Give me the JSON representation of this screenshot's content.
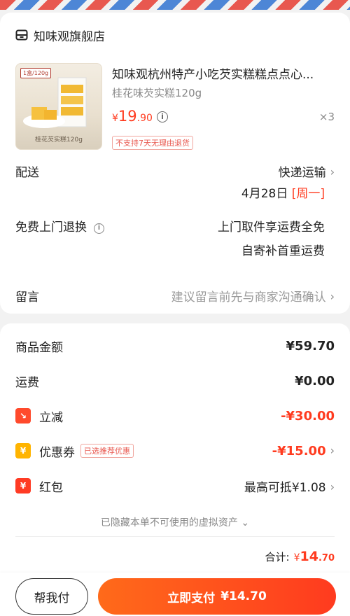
{
  "shop": {
    "name": "知味观旗舰店",
    "icon": "store-icon"
  },
  "product": {
    "title": "知味观杭州特产小吃芡实糕糕点点心...",
    "spec": "桂花味芡实糕120g",
    "price_symbol": "¥",
    "price_int": "19",
    "price_dec": ".90",
    "quantity": "×3",
    "policy_badge": "不支持7天无理由退货",
    "thumb_tag": "1盒/120g",
    "thumb_caption": "桂花芡实糕120g"
  },
  "delivery": {
    "label": "配送",
    "method": "快递运输",
    "date": "4月28日",
    "weekday": "[周一]"
  },
  "return_service": {
    "label": "免费上门退换",
    "line1": "上门取件享运费全免",
    "line2": "自寄补首重运费"
  },
  "message": {
    "label": "留言",
    "placeholder": "建议留言前先与商家沟通确认"
  },
  "fees": {
    "goods_label": "商品金额",
    "goods_value": "¥59.70",
    "shipping_label": "运费",
    "shipping_value": "¥0.00",
    "discount_label": "立减",
    "discount_value": "-¥30.00",
    "coupon_label": "优惠券",
    "coupon_tag": "已选推荐优惠",
    "coupon_value": "-¥15.00",
    "redpack_label": "红包",
    "redpack_value": "最高可抵¥1.08"
  },
  "hidden_note": "已隐藏本单不可使用的虚拟资产",
  "total": {
    "label": "合计:",
    "symbol": "¥",
    "int": "14",
    "dec": ".70"
  },
  "buttons": {
    "help": "帮我付",
    "pay": "立即支付",
    "pay_amount": "¥14.70"
  },
  "colors": {
    "accent": "#ff3b1f",
    "muted": "#888888"
  }
}
